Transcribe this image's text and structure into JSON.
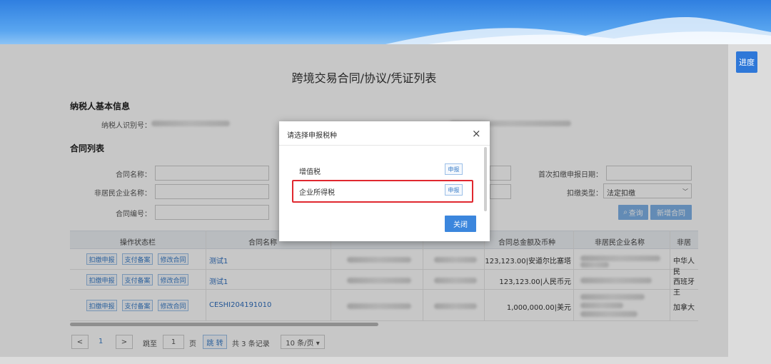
{
  "header": {
    "progress_button": "进度"
  },
  "page": {
    "title": "跨境交易合同/协议/凭证列表"
  },
  "taxpayer": {
    "section_title": "纳税人基本信息",
    "id_label": "纳税人识别号："
  },
  "contract_list": {
    "section_title": "合同列表",
    "fields": {
      "contract_name_label": "合同名称：",
      "nonresident_name_label": "非居民企业名称：",
      "contract_no_label": "合同编号：",
      "first_date_label": "首次扣缴申报日期：",
      "withholding_type_label": "扣缴类型：",
      "withholding_type_value": "法定扣缴"
    },
    "buttons": {
      "query": "查询",
      "new_contract": "新增合同"
    },
    "table": {
      "headers": [
        "操作状态栏",
        "合同名称",
        "合同总金额及币种",
        "非居民企业名称",
        "非居"
      ],
      "row_actions": [
        "扣缴申报",
        "支付备案",
        "修改合同"
      ],
      "rows": [
        {
          "name": "测试1",
          "amount": "123,123.00|安道尔比塞塔",
          "country": "中华人民"
        },
        {
          "name": "测试1",
          "amount": "123,123.00|人民币元",
          "country": "西班牙王"
        },
        {
          "name": "CESHI204191010",
          "amount": "1,000,000.00|美元",
          "country": "加拿大"
        }
      ]
    }
  },
  "pagination": {
    "prev": "<",
    "page": "1",
    "next": ">",
    "goto_label": "跳至",
    "goto_value": "1",
    "page_unit": "页",
    "jump_button": "跳 转",
    "total": "共 3 条记录",
    "page_size": "10 条/页 ▾"
  },
  "modal": {
    "title": "请选择申报税种",
    "close": "×",
    "options": [
      {
        "label": "增值税",
        "button": "申报"
      },
      {
        "label": "企业所得税",
        "button": "申报"
      }
    ],
    "close_button": "关闭"
  },
  "colors": {
    "accent": "#3b86dd",
    "highlight": "#e0282f"
  }
}
